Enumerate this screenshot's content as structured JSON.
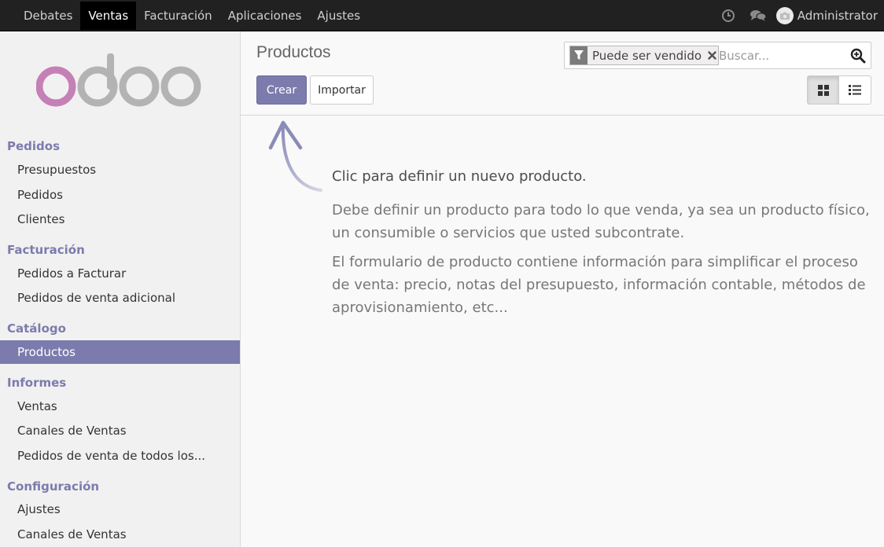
{
  "topbar": {
    "menu": [
      {
        "label": "Debates",
        "active": false
      },
      {
        "label": "Ventas",
        "active": true
      },
      {
        "label": "Facturación",
        "active": false
      },
      {
        "label": "Aplicaciones",
        "active": false
      },
      {
        "label": "Ajustes",
        "active": false
      }
    ],
    "icons": [
      "clock-icon",
      "chat-icon"
    ],
    "user": "Administrator"
  },
  "sidebar": {
    "logo": "odoo",
    "sections": [
      {
        "title": "Pedidos",
        "items": [
          "Presupuestos",
          "Pedidos",
          "Clientes"
        ]
      },
      {
        "title": "Facturación",
        "items": [
          "Pedidos a Facturar",
          "Pedidos de venta adicional"
        ]
      },
      {
        "title": "Catálogo",
        "items": [
          "Productos"
        ]
      },
      {
        "title": "Informes",
        "items": [
          "Ventas",
          "Canales de Ventas",
          "Pedidos de venta de todos los..."
        ]
      },
      {
        "title": "Configuración",
        "items": [
          "Ajustes",
          "Canales de Ventas"
        ]
      }
    ],
    "active_item": "Productos"
  },
  "control_panel": {
    "title": "Productos",
    "create_label": "Crear",
    "import_label": "Importar",
    "search": {
      "facet_label": "Puede ser vendido",
      "placeholder": "Buscar..."
    },
    "views": [
      "kanban-view-icon",
      "list-view-icon"
    ],
    "active_view": "kanban"
  },
  "help": {
    "title": "Clic para definir un nuevo producto.",
    "p1": "Debe definir un producto para todo lo que venda, ya sea un producto físico, un consumible o servicios que usted subcontrate.",
    "p2": "El formulario de producto contiene información para simplificar el proceso de venta: precio, notas del presupuesto, información contable, métodos de aprovisionamiento, etc..."
  },
  "colors": {
    "brand": "#7c7bad",
    "topbar": "#212121",
    "logo_o": "#c580b6",
    "logo_grey": "#b3b3b3"
  }
}
